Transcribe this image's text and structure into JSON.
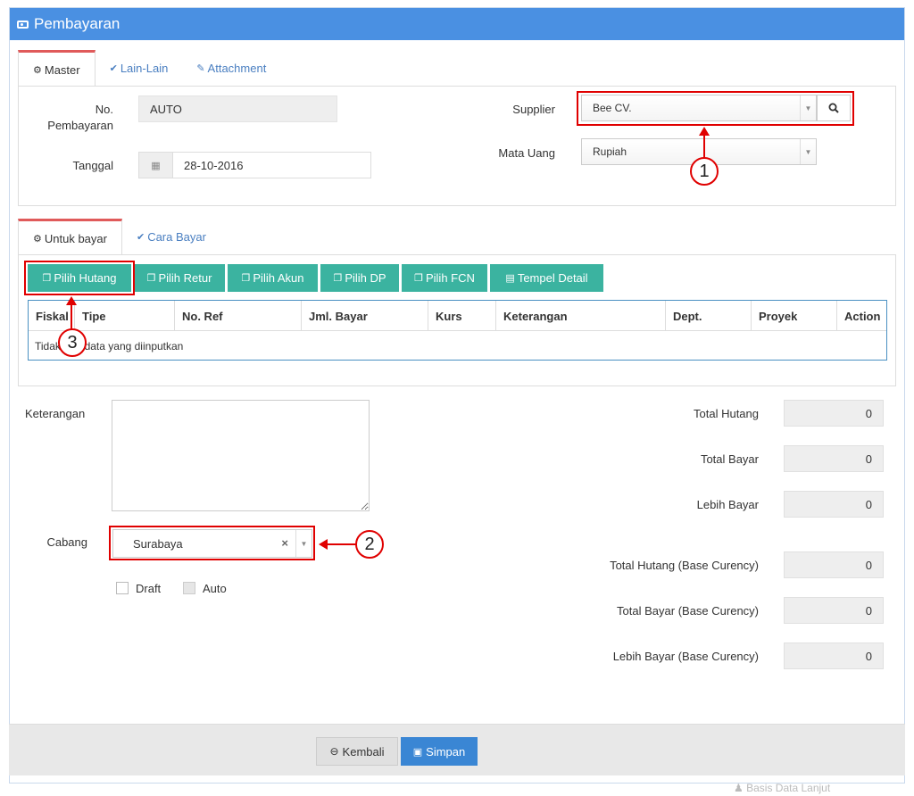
{
  "header": {
    "title": "Pembayaran",
    "icon": "money-icon"
  },
  "master_tabs": [
    {
      "label": "Master",
      "icon": "gears-icon"
    },
    {
      "label": "Lain-Lain",
      "icon": "check-circle-icon"
    },
    {
      "label": "Attachment",
      "icon": "paperclip-icon"
    }
  ],
  "master": {
    "no_pembayaran_label_1": "No.",
    "no_pembayaran_label_2": "Pembayaran",
    "no_pembayaran_value": "AUTO",
    "tanggal_label": "Tanggal",
    "tanggal_value": "28-10-2016",
    "supplier_label": "Supplier",
    "supplier_value": "Bee CV.",
    "mata_uang_label": "Mata Uang",
    "mata_uang_value": "Rupiah"
  },
  "detail_tabs": [
    {
      "label": "Untuk bayar",
      "icon": "gears-icon"
    },
    {
      "label": "Cara Bayar",
      "icon": "check-circle-icon"
    }
  ],
  "toolbar": {
    "pilih_hutang": "Pilih Hutang",
    "pilih_retur": "Pilih Retur",
    "pilih_akun": "Pilih Akun",
    "pilih_dp": "Pilih DP",
    "pilih_fcn": "Pilih FCN",
    "tempel_detail": "Tempel Detail"
  },
  "table": {
    "columns": [
      "Fiskal",
      "Tipe",
      "No. Ref",
      "Jml. Bayar",
      "Kurs",
      "Keterangan",
      "Dept.",
      "Proyek",
      "Action"
    ],
    "empty_message": "Tidak ada data yang diinputkan"
  },
  "form": {
    "keterangan_label": "Keterangan",
    "keterangan_value": "",
    "cabang_label": "Cabang",
    "cabang_value": "Surabaya",
    "draft_label": "Draft",
    "auto_label": "Auto"
  },
  "totals": [
    {
      "label": "Total Hutang",
      "value": "0"
    },
    {
      "label": "Total Bayar",
      "value": "0"
    },
    {
      "label": "Lebih Bayar",
      "value": "0"
    },
    {
      "label": "Total Hutang (Base Curency)",
      "value": "0"
    },
    {
      "label": "Total Bayar (Base Curency)",
      "value": "0"
    },
    {
      "label": "Lebih Bayar (Base Curency)",
      "value": "0"
    }
  ],
  "annotations": {
    "one": "1",
    "two": "2",
    "three": "3"
  },
  "footer": {
    "kembali": "Kembali",
    "simpan": "Simpan"
  },
  "watermark": "Basis Data Lanjut"
}
